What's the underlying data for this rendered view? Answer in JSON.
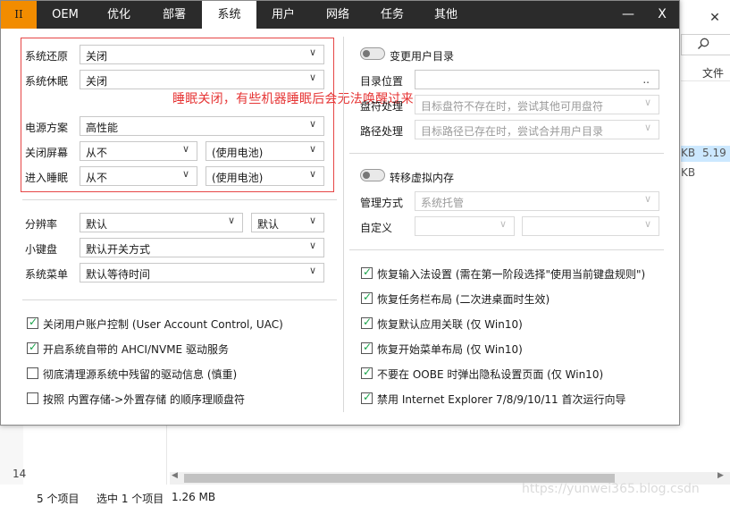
{
  "background_window": {
    "column_header": "文件",
    "selected_row_size_suffix": "KB",
    "selected_row_value": "5.19",
    "second_row_size_suffix": "KB",
    "left_pane_number": "14",
    "status": {
      "item_count": "5 个项目",
      "selected": "选中 1 个项目",
      "size": "1.26 MB"
    },
    "watermark": "https://yunwei365.blog.csdn"
  },
  "titlebar": {
    "logo": "II",
    "tabs": [
      "OEM",
      "优化",
      "部署",
      "系统",
      "用户",
      "网络",
      "任务",
      "其他"
    ],
    "active_tab": "系统",
    "minimize": "—",
    "close": "X"
  },
  "left": {
    "restore": {
      "label": "系统还原",
      "value": "关闭"
    },
    "hibernate": {
      "label": "系统休眠",
      "value": "关闭"
    },
    "power_plan": {
      "label": "电源方案",
      "value": "高性能"
    },
    "screen_off": {
      "label": "关闭屏幕",
      "value": "从不",
      "battery": "(使用电池)"
    },
    "sleep": {
      "label": "进入睡眠",
      "value": "从不",
      "battery": "(使用电池)"
    },
    "resolution": {
      "label": "分辨率",
      "value": "默认",
      "value2": "默认"
    },
    "numlock": {
      "label": "小键盘",
      "value": "默认开关方式"
    },
    "sys_menu": {
      "label": "系统菜单",
      "value": "默认等待时间"
    },
    "checkboxes": [
      {
        "label": "关闭用户账户控制 (User Account Control, UAC)",
        "checked": true
      },
      {
        "label": "开启系统自带的 AHCI/NVME 驱动服务",
        "checked": true
      },
      {
        "label": "彻底清理源系统中残留的驱动信息 (慎重)",
        "checked": false
      },
      {
        "label": "按照 内置存储->外置存储 的顺序理顺盘符",
        "checked": false
      }
    ]
  },
  "annotation": "睡眠关闭，有些机器睡眠后会无法唤醒过来",
  "right": {
    "user_dir": {
      "toggle_label": "变更用户目录",
      "dir_label": "目录位置",
      "dir_button": "..",
      "drive_label": "盘符处理",
      "drive_value": "目标盘符不存在时，尝试其他可用盘符",
      "path_label": "路径处理",
      "path_value": "目标路径已存在时，尝试合并用户目录"
    },
    "virtual_memory": {
      "toggle_label": "转移虚拟内存",
      "mode_label": "管理方式",
      "mode_value": "系统托管",
      "custom_label": "自定义",
      "custom_value1": "",
      "custom_value2": ""
    },
    "checkboxes": [
      {
        "label": "恢复输入法设置 (需在第一阶段选择\"使用当前键盘规则\")",
        "checked": true
      },
      {
        "label": "恢复任务栏布局 (二次进桌面时生效)",
        "checked": true
      },
      {
        "label": "恢复默认应用关联 (仅 Win10)",
        "checked": true
      },
      {
        "label": "恢复开始菜单布局 (仅 Win10)",
        "checked": true
      },
      {
        "label": "不要在 OOBE 时弹出隐私设置页面 (仅 Win10)",
        "checked": true
      },
      {
        "label": "禁用 Internet Explorer 7/8/9/10/11 首次运行向导",
        "checked": true
      }
    ]
  },
  "glyphs": {
    "chevron": "∨",
    "check": "✓"
  },
  "colors": {
    "titlebar": "#2b2b2b",
    "logo_tab": "#f28c00",
    "annotation": "#e63535",
    "check": "#1aa34a",
    "selection": "#cce8ff"
  }
}
